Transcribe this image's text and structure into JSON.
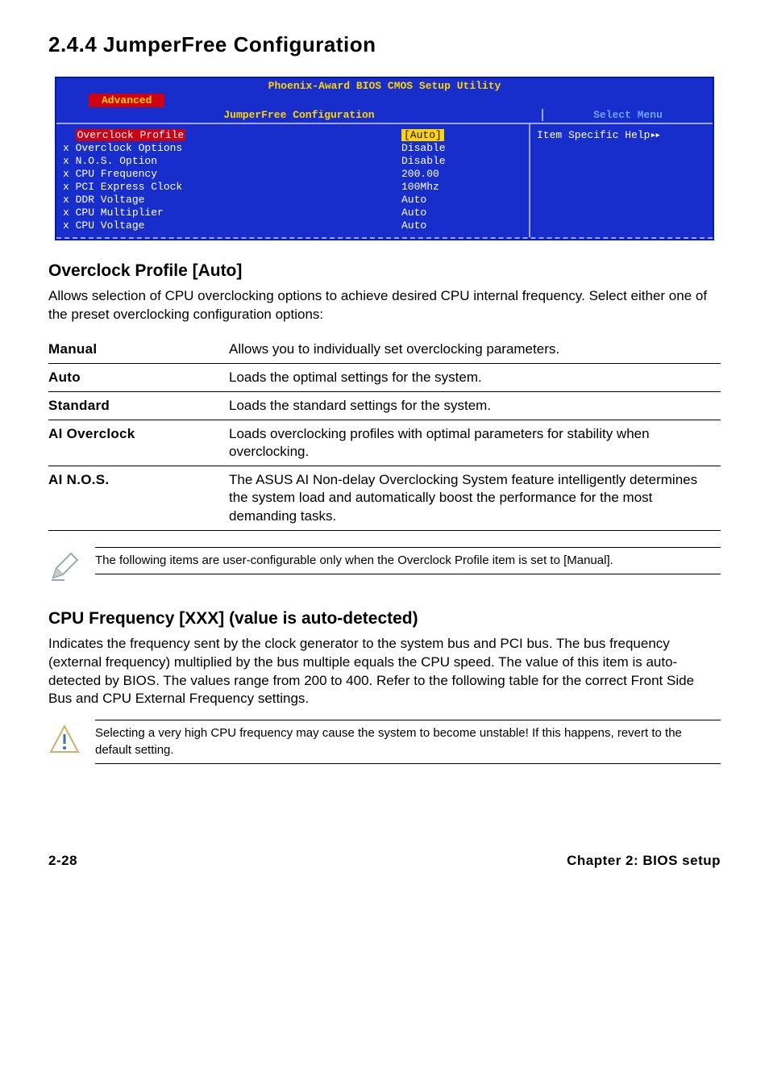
{
  "section": {
    "number_title": "2.4.4   JumperFree Configuration"
  },
  "bios": {
    "title": "Phoenix-Award BIOS CMOS Setup Utility",
    "tab": "Advanced",
    "subheader_left": "JumperFree Configuration",
    "subheader_right": "Select Menu",
    "help_text": "Item Specific Help",
    "rows": [
      {
        "label": "  Overclock Profile",
        "value": "[Auto]",
        "hl": true
      },
      {
        "label": "x Overclock Options",
        "value": "Disable"
      },
      {
        "label": "x N.O.S. Option",
        "value": "Disable"
      },
      {
        "label": "x CPU Frequency",
        "value": "200.00"
      },
      {
        "label": "x PCI Express Clock",
        "value": "100Mhz"
      },
      {
        "label": "x DDR Voltage",
        "value": "Auto"
      },
      {
        "label": "x CPU Multiplier",
        "value": "Auto"
      },
      {
        "label": "x CPU Voltage",
        "value": "Auto"
      }
    ]
  },
  "overclock": {
    "heading": "Overclock Profile [Auto]",
    "body": "Allows selection of CPU overclocking options to achieve desired CPU internal frequency. Select either one of the preset overclocking configuration options:"
  },
  "modes": [
    {
      "k": "Manual",
      "v": "Allows you to individually set overclocking parameters."
    },
    {
      "k": "Auto",
      "v": "Loads the optimal settings for the system."
    },
    {
      "k": "Standard",
      "v": "Loads the standard settings for the system."
    },
    {
      "k": "AI Overclock",
      "v": "Loads overclocking profiles with optimal parameters for stability when overclocking."
    },
    {
      "k": "AI N.O.S.",
      "v": "The ASUS AI Non-delay Overclocking System feature intelligently determines the system load and automatically boost the performance for the most demanding tasks."
    }
  ],
  "note1": "The following items are user-configurable only when the Overclock Profile item is set to [Manual].",
  "cpufreq": {
    "heading_bold": "CPU Frequency [XXX] ",
    "heading_rest": "(value is auto-detected)",
    "body": "Indicates the frequency sent by the clock generator to the system bus and PCI bus. The bus frequency (external frequency) multiplied by the bus multiple equals the CPU speed. The value of this item is auto-detected by BIOS. The values range from 200 to 400. Refer to the following table for the correct Front Side Bus and CPU External Frequency settings."
  },
  "note2": "Selecting a very high CPU frequency may cause the system to become unstable! If this happens, revert to the default setting.",
  "footer": {
    "left": "2-28",
    "right": "Chapter 2: BIOS setup"
  }
}
